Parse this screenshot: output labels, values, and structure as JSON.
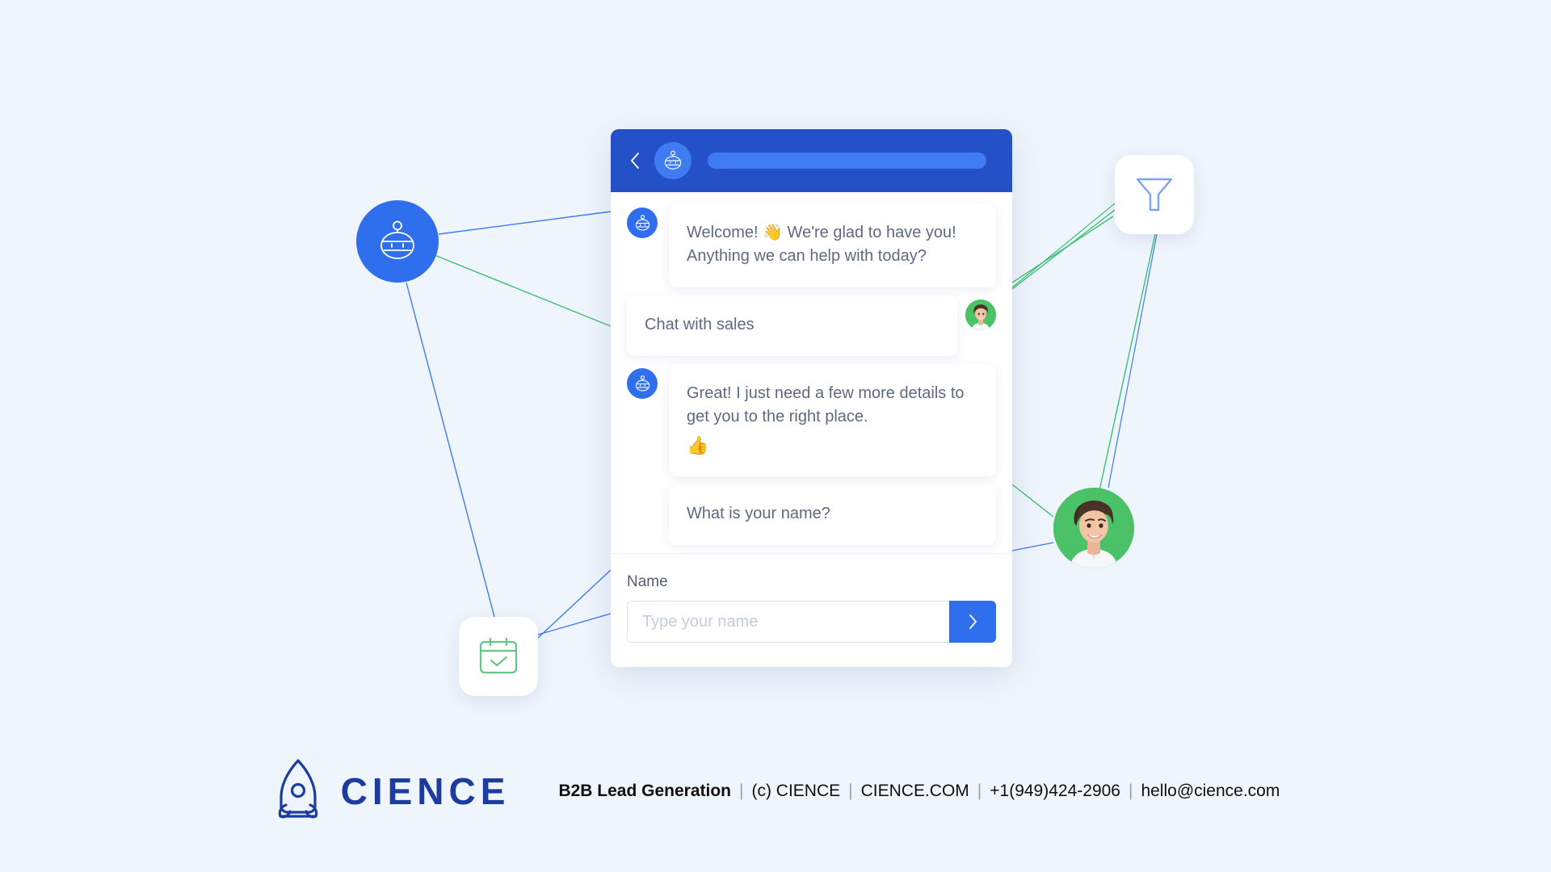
{
  "page": {
    "background_color": "#eff5fd",
    "accent_blue": "#2f6fed",
    "header_blue": "#2450c8",
    "accent_green": "#4cc268",
    "brand_navy": "#1d3ca0"
  },
  "widget": {
    "header": {
      "back_icon": "chevron-left-icon",
      "bot_icon": "robot-avatar-icon",
      "title_placeholder_bar": ""
    },
    "messages": [
      {
        "id": "welcome",
        "sender": "bot",
        "avatar_icon": "robot-avatar-icon",
        "text": "Welcome! 👋 We're glad to have you! Anything we can help with today?"
      },
      {
        "id": "chat-with-sales",
        "sender": "user",
        "avatar_icon": "person-avatar",
        "text": "Chat with sales"
      },
      {
        "id": "details",
        "sender": "bot",
        "avatar_icon": "robot-avatar-icon",
        "text": "Great! I just need a few more details to get you to the right place.",
        "emoji_line": "👍"
      },
      {
        "id": "ask-name",
        "sender": "bot",
        "avatar_icon": null,
        "text": "What is your name?"
      }
    ],
    "composer": {
      "label": "Name",
      "input_value": "",
      "input_placeholder": "Type your name",
      "send_icon": "chevron-right-icon",
      "send_label": ""
    }
  },
  "nodes": [
    {
      "id": "bot-circle",
      "icon": "robot-avatar-icon",
      "label": ""
    },
    {
      "id": "filter-card",
      "icon": "funnel-filter-icon",
      "label": ""
    },
    {
      "id": "calendar-card",
      "icon": "calendar-check-icon",
      "label": ""
    },
    {
      "id": "person-avatar",
      "icon": "person-avatar",
      "label": ""
    }
  ],
  "footer": {
    "logo_icon": "cience-rocket-logo",
    "brand_name": "CIENCE",
    "tagline": "B2B Lead Generation",
    "copyright": "(c) CIENCE",
    "website": "CIENCE.COM",
    "phone": "+1(949)424-2906",
    "email": "hello@cience.com",
    "separator": "|"
  }
}
